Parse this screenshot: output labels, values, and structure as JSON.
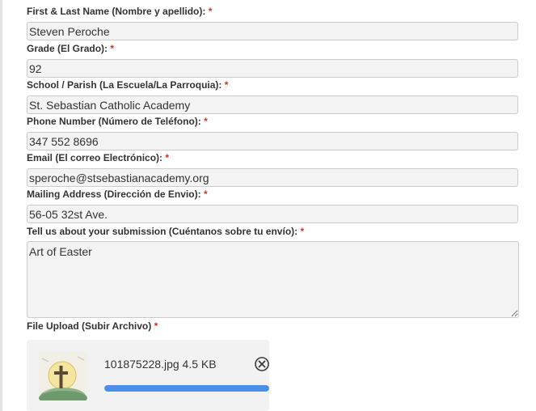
{
  "required_marker": "*",
  "fields": {
    "name": {
      "label": "First & Last Name (Nombre y apellido):",
      "value": "Steven Peroche"
    },
    "grade": {
      "label": "Grade (El Grado):",
      "value": "92"
    },
    "school": {
      "label": "School / Parish (La Escuela/La Parroquia):",
      "value": "St. Sebastian Catholic Academy"
    },
    "phone": {
      "label": "Phone Number (Número de Teléfono):",
      "value": "347 552 8696"
    },
    "email": {
      "label": "Email (El correo Electrónico):",
      "value": "speroche@stsebastianacademy.org"
    },
    "address": {
      "label": "Mailing Address (Dirección de Envio):",
      "value": "56-05 32st Ave."
    },
    "submission": {
      "label": "Tell us about your submission (Cuéntanos sobre tu envío):",
      "value": "Art of Easter"
    }
  },
  "upload": {
    "label": "File Upload (Subir Archivo)",
    "file_name": "101875228.jpg",
    "file_size": "4.5 KB",
    "remove_icon": "remove-circle-icon",
    "progress": 1.0,
    "progress_color": "#4a8ee8"
  },
  "colors": {
    "required": "#c0392b",
    "field_bg": "#f3f3f3",
    "field_border": "#cccccc"
  }
}
